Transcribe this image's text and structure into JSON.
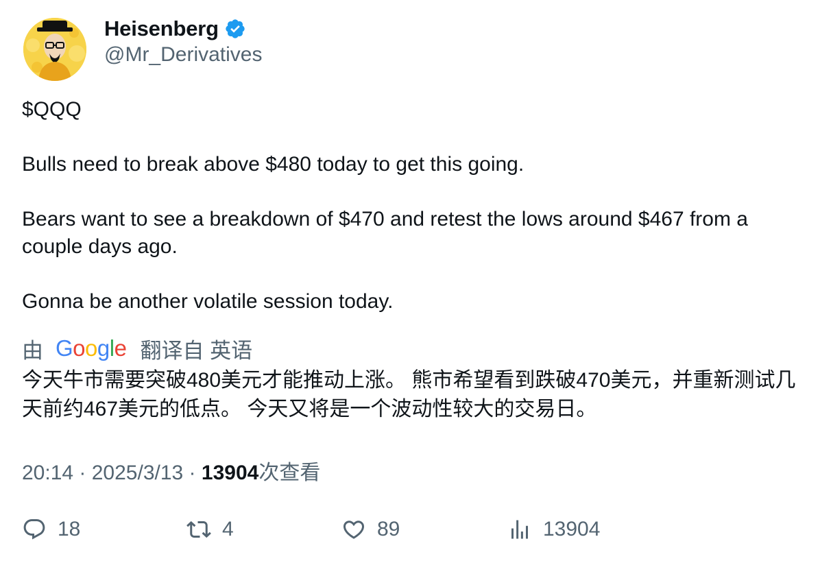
{
  "author": {
    "display_name": "Heisenberg",
    "handle": "@Mr_Derivatives",
    "avatar_icon": "heisenberg-avatar",
    "verified_icon": "verified-badge-icon",
    "verified_color": "#1d9bf0",
    "avatar_bg": "#f7d34a"
  },
  "tweet": {
    "paragraphs": [
      "$QQQ",
      "Bulls need to break above $480 today to get this going.",
      "Bears want to see a breakdown of $470 and retest the lows around $467 from a couple days ago.",
      "Gonna be another volatile session today."
    ]
  },
  "translation": {
    "by_label": "由",
    "provider": "Google",
    "from_label": "翻译自 英语",
    "text": "今天牛市需要突破480美元才能推动上涨。 熊市希望看到跌破470美元，并重新测试几天前约467美元的低点。 今天又将是一个波动性较大的交易日。"
  },
  "meta": {
    "time": "20:14",
    "separator": " · ",
    "date": "2025/3/13",
    "views_count": "13904",
    "views_label": "次查看"
  },
  "actions": {
    "reply": {
      "icon": "reply-icon",
      "count": "18"
    },
    "retweet": {
      "icon": "retweet-icon",
      "count": "4"
    },
    "like": {
      "icon": "heart-icon",
      "count": "89"
    },
    "views": {
      "icon": "analytics-icon",
      "count": "13904"
    }
  },
  "colors": {
    "text_primary": "#0f1419",
    "text_secondary": "#536471"
  }
}
